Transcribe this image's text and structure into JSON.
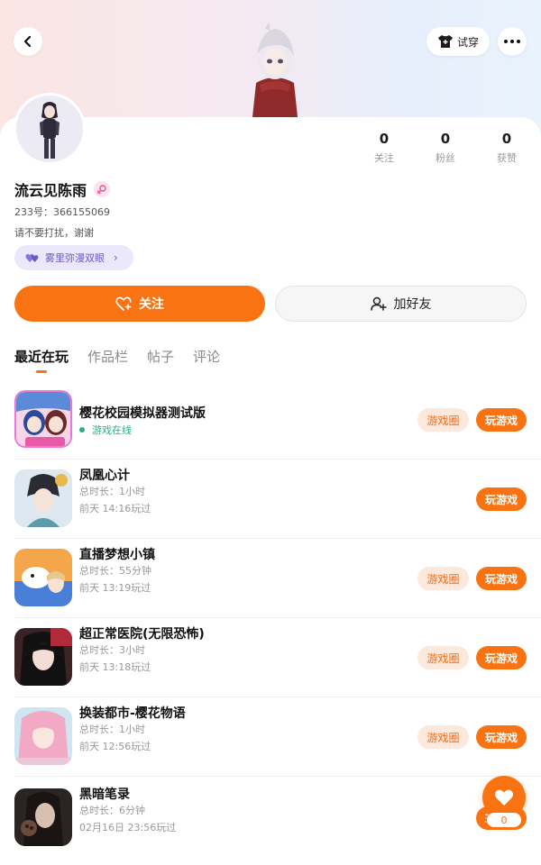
{
  "header": {
    "back_icon": "chevron-left-icon",
    "try_on_label": "试穿",
    "more_icon": "more-dots-icon"
  },
  "profile": {
    "name": "流云见陈雨",
    "gender": "female",
    "uid_label": "233号：",
    "uid": "366155069",
    "bio": "请不要打扰，谢谢",
    "tag_label": "雾里弥漫双眼",
    "stats": [
      {
        "count": "0",
        "label": "关注"
      },
      {
        "count": "0",
        "label": "粉丝"
      },
      {
        "count": "0",
        "label": "获赞"
      }
    ]
  },
  "actions": {
    "follow_label": "关注",
    "add_friend_label": "加好友"
  },
  "tabs": [
    {
      "label": "最近在玩",
      "active": true
    },
    {
      "label": "作品栏",
      "active": false
    },
    {
      "label": "帖子",
      "active": false
    },
    {
      "label": "评论",
      "active": false
    }
  ],
  "games": [
    {
      "title": "樱花校园模拟器测试版",
      "status": "游戏在线",
      "duration": "",
      "last_played": "",
      "has_circle": true
    },
    {
      "title": "凤凰心计",
      "status": "",
      "duration": "总时长：1小时",
      "last_played": "前天 14:16玩过",
      "has_circle": false
    },
    {
      "title": "直播梦想小镇",
      "status": "",
      "duration": "总时长：55分钟",
      "last_played": "前天 13:19玩过",
      "has_circle": true
    },
    {
      "title": "超正常医院(无限恐怖)",
      "status": "",
      "duration": "总时长：3小时",
      "last_played": "前天 13:18玩过",
      "has_circle": true
    },
    {
      "title": "换装都市-樱花物语",
      "status": "",
      "duration": "总时长：1小时",
      "last_played": "前天 12:56玩过",
      "has_circle": true
    },
    {
      "title": "黑暗笔录",
      "status": "",
      "duration": "总时长：6分钟",
      "last_played": "02月16日 23:56玩过",
      "has_circle": false
    }
  ],
  "game_buttons": {
    "circle_label": "游戏圈",
    "play_label": "玩游戏"
  },
  "fab": {
    "icon": "heart-icon",
    "count": "0"
  },
  "colors": {
    "accent": "#fa7312",
    "online": "#2ab07a",
    "tag_purple": "#6a58c9"
  }
}
